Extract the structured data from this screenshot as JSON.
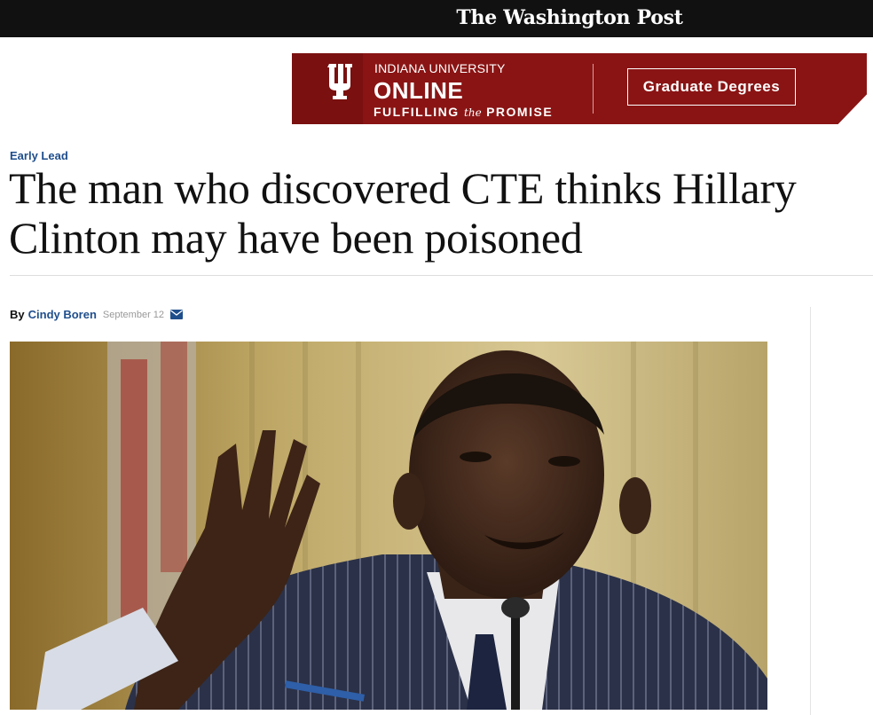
{
  "masthead": {
    "title": "The Washington Post"
  },
  "ad": {
    "line1": "INDIANA UNIVERSITY",
    "line2": "ONLINE",
    "line3_a": "FULFILLING",
    "line3_the": "the",
    "line3_b": "PROMISE",
    "cta": "Graduate Degrees",
    "logo_icon": "iu-trident-icon",
    "brand_color": "#8a1414"
  },
  "article": {
    "kicker": "Early Lead",
    "headline": "The man who discovered CTE thinks Hillary Clinton may have been poisoned",
    "byline": {
      "by": "By",
      "author": "Cindy Boren",
      "date": "September 12",
      "share_icon": "email-icon"
    },
    "photo_subject": "man-speaking-at-hearing-photo"
  },
  "colors": {
    "link": "#1f4e8c",
    "topbar": "#111111"
  }
}
